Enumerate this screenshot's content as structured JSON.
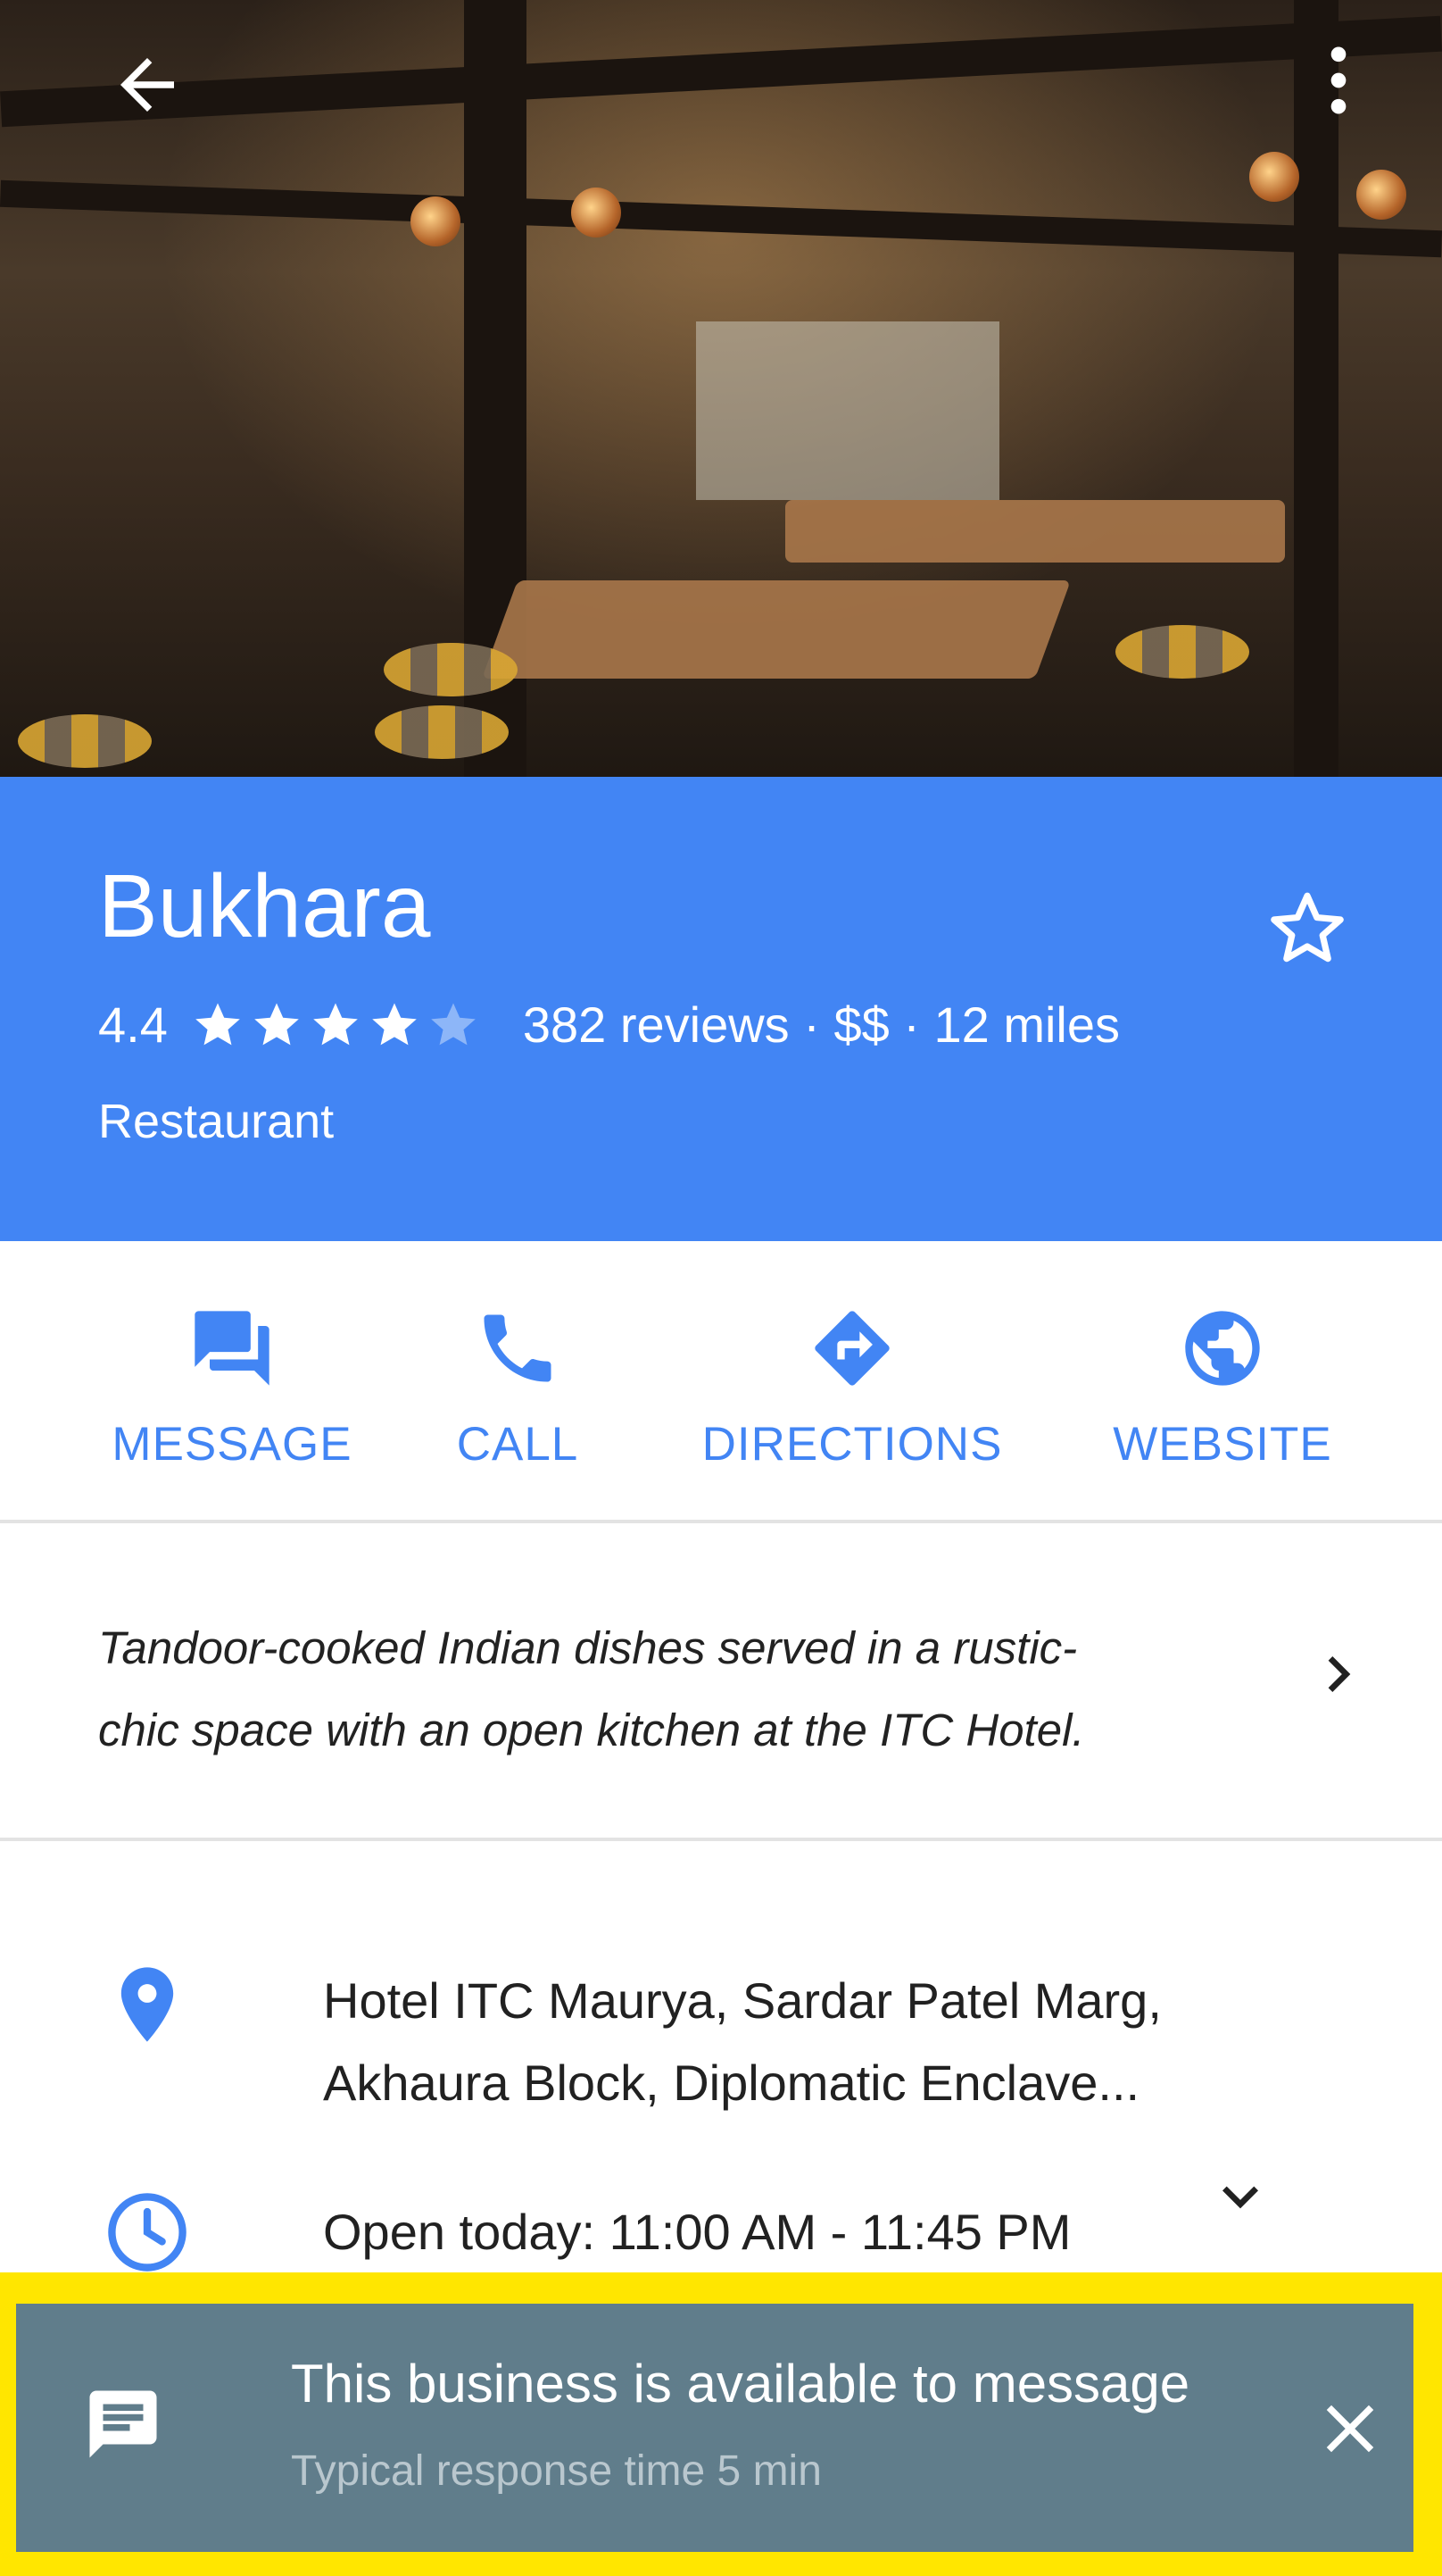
{
  "place": {
    "name": "Bukhara",
    "rating": "4.4",
    "rating_value": 4.4,
    "rating_max": 5,
    "summary": "382 reviews · $$ · 12 miles",
    "category": "Restaurant"
  },
  "actions": [
    {
      "label": "MESSAGE",
      "icon": "message-icon"
    },
    {
      "label": "CALL",
      "icon": "phone-icon"
    },
    {
      "label": "DIRECTIONS",
      "icon": "directions-icon"
    },
    {
      "label": "WEBSITE",
      "icon": "globe-icon"
    }
  ],
  "description": {
    "line1": "Tandoor-cooked Indian dishes served in a rustic-",
    "line2": "chic space with an open kitchen at the ITC Hotel."
  },
  "address": {
    "line1": "Hotel ITC Maurya, Sardar Patel Marg,",
    "line2": "Akhaura Block, Diplomatic Enclave..."
  },
  "hours": {
    "text": "Open today: 11:00 AM - 11:45 PM"
  },
  "message_banner": {
    "title": "This business is available to message",
    "subtitle": "Typical response time 5 min"
  },
  "colors": {
    "primary": "#4285f4",
    "banner": "#607d8b",
    "highlight": "#ffe600"
  }
}
